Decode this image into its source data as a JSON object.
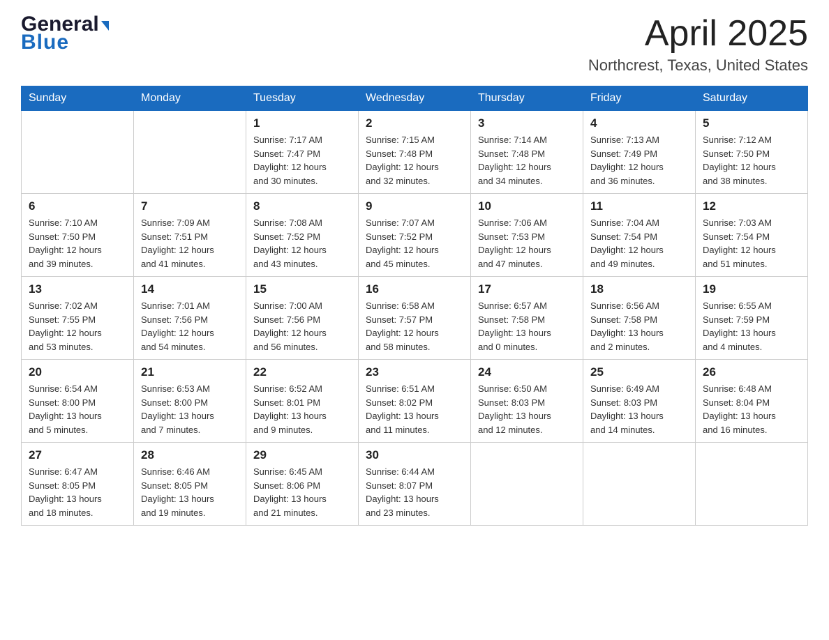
{
  "header": {
    "title": "April 2025",
    "subtitle": "Northcrest, Texas, United States",
    "logo_general": "General",
    "logo_blue": "Blue"
  },
  "weekdays": [
    "Sunday",
    "Monday",
    "Tuesday",
    "Wednesday",
    "Thursday",
    "Friday",
    "Saturday"
  ],
  "weeks": [
    [
      {
        "day": "",
        "info": ""
      },
      {
        "day": "",
        "info": ""
      },
      {
        "day": "1",
        "info": "Sunrise: 7:17 AM\nSunset: 7:47 PM\nDaylight: 12 hours\nand 30 minutes."
      },
      {
        "day": "2",
        "info": "Sunrise: 7:15 AM\nSunset: 7:48 PM\nDaylight: 12 hours\nand 32 minutes."
      },
      {
        "day": "3",
        "info": "Sunrise: 7:14 AM\nSunset: 7:48 PM\nDaylight: 12 hours\nand 34 minutes."
      },
      {
        "day": "4",
        "info": "Sunrise: 7:13 AM\nSunset: 7:49 PM\nDaylight: 12 hours\nand 36 minutes."
      },
      {
        "day": "5",
        "info": "Sunrise: 7:12 AM\nSunset: 7:50 PM\nDaylight: 12 hours\nand 38 minutes."
      }
    ],
    [
      {
        "day": "6",
        "info": "Sunrise: 7:10 AM\nSunset: 7:50 PM\nDaylight: 12 hours\nand 39 minutes."
      },
      {
        "day": "7",
        "info": "Sunrise: 7:09 AM\nSunset: 7:51 PM\nDaylight: 12 hours\nand 41 minutes."
      },
      {
        "day": "8",
        "info": "Sunrise: 7:08 AM\nSunset: 7:52 PM\nDaylight: 12 hours\nand 43 minutes."
      },
      {
        "day": "9",
        "info": "Sunrise: 7:07 AM\nSunset: 7:52 PM\nDaylight: 12 hours\nand 45 minutes."
      },
      {
        "day": "10",
        "info": "Sunrise: 7:06 AM\nSunset: 7:53 PM\nDaylight: 12 hours\nand 47 minutes."
      },
      {
        "day": "11",
        "info": "Sunrise: 7:04 AM\nSunset: 7:54 PM\nDaylight: 12 hours\nand 49 minutes."
      },
      {
        "day": "12",
        "info": "Sunrise: 7:03 AM\nSunset: 7:54 PM\nDaylight: 12 hours\nand 51 minutes."
      }
    ],
    [
      {
        "day": "13",
        "info": "Sunrise: 7:02 AM\nSunset: 7:55 PM\nDaylight: 12 hours\nand 53 minutes."
      },
      {
        "day": "14",
        "info": "Sunrise: 7:01 AM\nSunset: 7:56 PM\nDaylight: 12 hours\nand 54 minutes."
      },
      {
        "day": "15",
        "info": "Sunrise: 7:00 AM\nSunset: 7:56 PM\nDaylight: 12 hours\nand 56 minutes."
      },
      {
        "day": "16",
        "info": "Sunrise: 6:58 AM\nSunset: 7:57 PM\nDaylight: 12 hours\nand 58 minutes."
      },
      {
        "day": "17",
        "info": "Sunrise: 6:57 AM\nSunset: 7:58 PM\nDaylight: 13 hours\nand 0 minutes."
      },
      {
        "day": "18",
        "info": "Sunrise: 6:56 AM\nSunset: 7:58 PM\nDaylight: 13 hours\nand 2 minutes."
      },
      {
        "day": "19",
        "info": "Sunrise: 6:55 AM\nSunset: 7:59 PM\nDaylight: 13 hours\nand 4 minutes."
      }
    ],
    [
      {
        "day": "20",
        "info": "Sunrise: 6:54 AM\nSunset: 8:00 PM\nDaylight: 13 hours\nand 5 minutes."
      },
      {
        "day": "21",
        "info": "Sunrise: 6:53 AM\nSunset: 8:00 PM\nDaylight: 13 hours\nand 7 minutes."
      },
      {
        "day": "22",
        "info": "Sunrise: 6:52 AM\nSunset: 8:01 PM\nDaylight: 13 hours\nand 9 minutes."
      },
      {
        "day": "23",
        "info": "Sunrise: 6:51 AM\nSunset: 8:02 PM\nDaylight: 13 hours\nand 11 minutes."
      },
      {
        "day": "24",
        "info": "Sunrise: 6:50 AM\nSunset: 8:03 PM\nDaylight: 13 hours\nand 12 minutes."
      },
      {
        "day": "25",
        "info": "Sunrise: 6:49 AM\nSunset: 8:03 PM\nDaylight: 13 hours\nand 14 minutes."
      },
      {
        "day": "26",
        "info": "Sunrise: 6:48 AM\nSunset: 8:04 PM\nDaylight: 13 hours\nand 16 minutes."
      }
    ],
    [
      {
        "day": "27",
        "info": "Sunrise: 6:47 AM\nSunset: 8:05 PM\nDaylight: 13 hours\nand 18 minutes."
      },
      {
        "day": "28",
        "info": "Sunrise: 6:46 AM\nSunset: 8:05 PM\nDaylight: 13 hours\nand 19 minutes."
      },
      {
        "day": "29",
        "info": "Sunrise: 6:45 AM\nSunset: 8:06 PM\nDaylight: 13 hours\nand 21 minutes."
      },
      {
        "day": "30",
        "info": "Sunrise: 6:44 AM\nSunset: 8:07 PM\nDaylight: 13 hours\nand 23 minutes."
      },
      {
        "day": "",
        "info": ""
      },
      {
        "day": "",
        "info": ""
      },
      {
        "day": "",
        "info": ""
      }
    ]
  ]
}
